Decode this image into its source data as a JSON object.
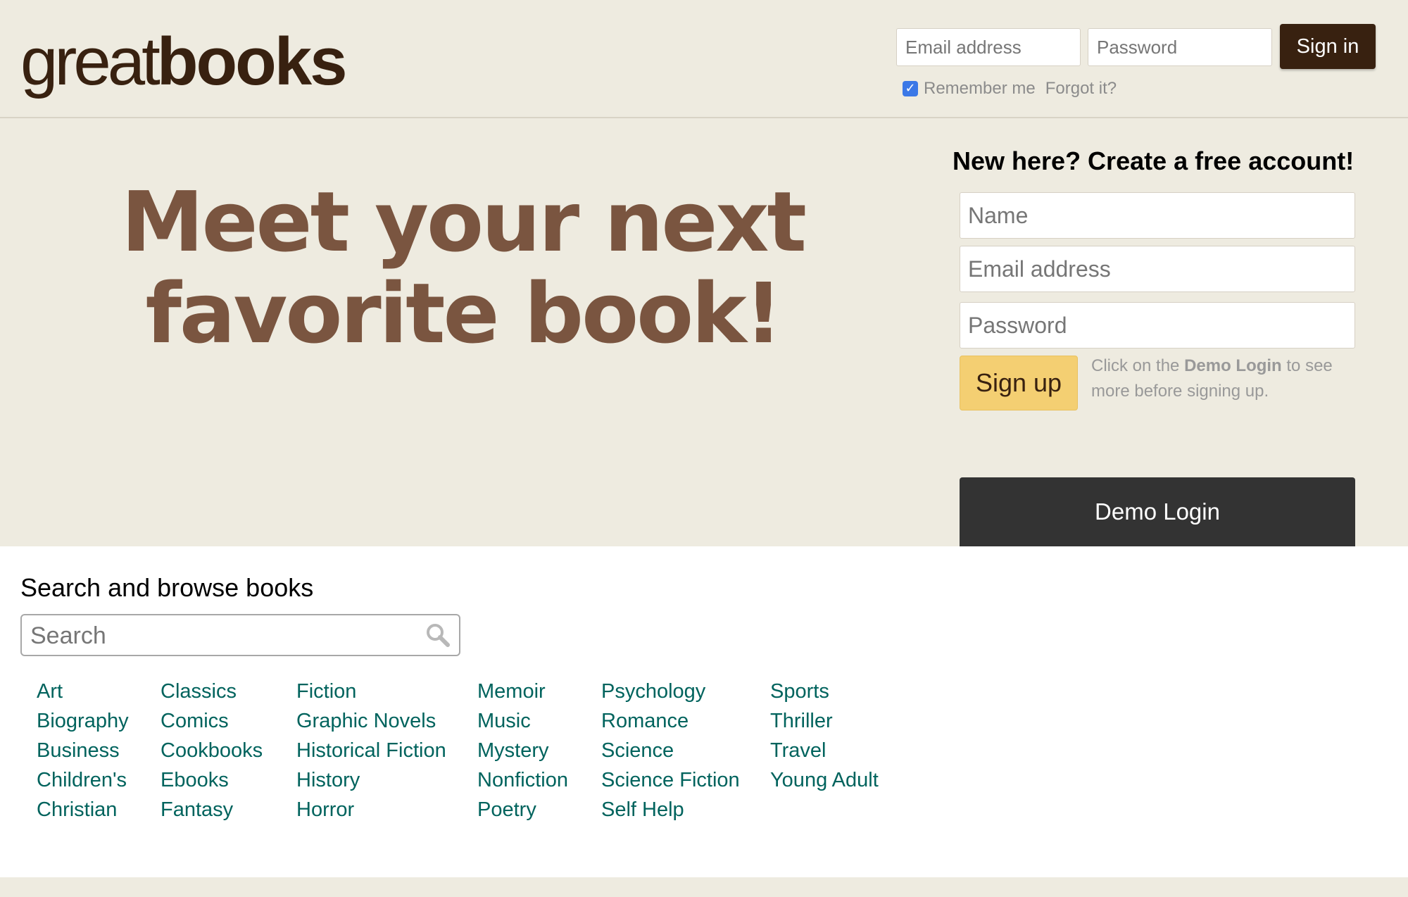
{
  "header": {
    "logo_thin": "great",
    "logo_bold": "books",
    "email_placeholder": "Email address",
    "password_placeholder": "Password",
    "signin_label": "Sign in",
    "remember_label": "Remember me",
    "remember_checked": true,
    "forgot_label": "Forgot it?"
  },
  "hero": {
    "line1": "Meet your next",
    "line2": "favorite book!"
  },
  "signup": {
    "heading": "New here? Create a free account!",
    "name_placeholder": "Name",
    "email_placeholder": "Email address",
    "password_placeholder": "Password",
    "button_label": "Sign up",
    "note_before": "Click on the ",
    "note_bold": "Demo Login",
    "note_after": " to see more before signing up.",
    "demo_label": "Demo Login"
  },
  "browse": {
    "title": "Search and browse books",
    "search_placeholder": "Search",
    "search_icon": "magnifier-icon",
    "columns": [
      [
        "Art",
        "Biography",
        "Business",
        "Children's",
        "Christian"
      ],
      [
        "Classics",
        "Comics",
        "Cookbooks",
        "Ebooks",
        "Fantasy"
      ],
      [
        "Fiction",
        "Graphic Novels",
        "Historical Fiction",
        "History",
        "Horror"
      ],
      [
        "Memoir",
        "Music",
        "Mystery",
        "Nonfiction",
        "Poetry"
      ],
      [
        "Psychology",
        "Romance",
        "Science",
        "Science Fiction",
        "Self Help"
      ],
      [
        "Sports",
        "Thriller",
        "Travel",
        "Young Adult"
      ]
    ]
  },
  "colors": {
    "background": "#eeebe0",
    "brand_dark": "#382110",
    "hero_text": "#7a5540",
    "signup_button": "#f4cf72",
    "demo_button": "#333333",
    "link": "#00635d",
    "checkbox": "#3b78e7"
  }
}
